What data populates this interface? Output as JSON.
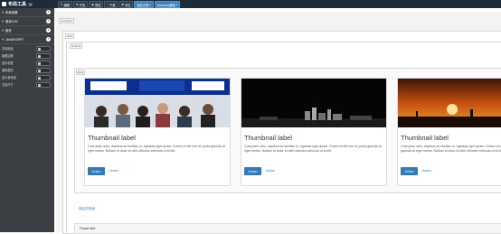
{
  "app": {
    "title": "布局工具",
    "version": "v3"
  },
  "toolbar": [
    {
      "label": "编辑",
      "icon": "edit-icon"
    },
    {
      "label": "开发",
      "icon": "code-icon"
    },
    {
      "label": "预览",
      "icon": "eye-icon"
    },
    {
      "label": "下载",
      "icon": "download-icon"
    },
    {
      "label": "清空",
      "icon": "trash-icon"
    },
    {
      "label": "保存记录",
      "icon": "history-icon",
      "primary": true
    },
    {
      "label": "Bootstrap模板",
      "icon": "template-icon",
      "primary": true
    }
  ],
  "sidebar": {
    "sections": [
      "布局设置",
      "基本CSS",
      "组件",
      "JAVASCRIPT"
    ],
    "toggles": [
      "背景颜色",
      "隐藏边框",
      "显示标签",
      "源码模式",
      "显示参考线",
      "文档尺寸"
    ]
  },
  "canvas": {
    "tags": {
      "container": "Container",
      "row1": "Row",
      "column": "Column",
      "row2": "Row"
    },
    "cards": [
      {
        "title": "Thumbnail label",
        "text": "Cras justo odio, dapibus ac facilisis in, egestas eget quam. Donec id elit non mi porta gravida at eget metus. Nullam id dolor id nibh ultricies vehicula ut id elit.",
        "action": "Action",
        "link": "Action",
        "image": "crowd-photo"
      },
      {
        "title": "Thumbnail label",
        "text": "Cras justo odio, dapibus ac facilisis in, egestas eget quam. Donec id elit non mi porta gravida at eget metus. Nullam id dolor id nibh ultricies vehicula ut id elit.",
        "action": "Action",
        "link": "Action",
        "image": "city-skyline-photo"
      },
      {
        "title": "Thumbnail label",
        "text": "Cras justo odio, dapibus ac facilisis in, egestas eget quam. Donec id elit non mi porta gravida at eget metus. Nullam id dolor id nibh ultricies vehicula ut id elit.",
        "action": "Action",
        "link": "Action",
        "image": "sunset-photo"
      }
    ],
    "bottom_link": "响应式布局",
    "panel_title": "Panel title"
  },
  "colors": {
    "topbar": "#1e2b38",
    "sidebar": "#3b3f44",
    "primary": "#337ab7"
  }
}
